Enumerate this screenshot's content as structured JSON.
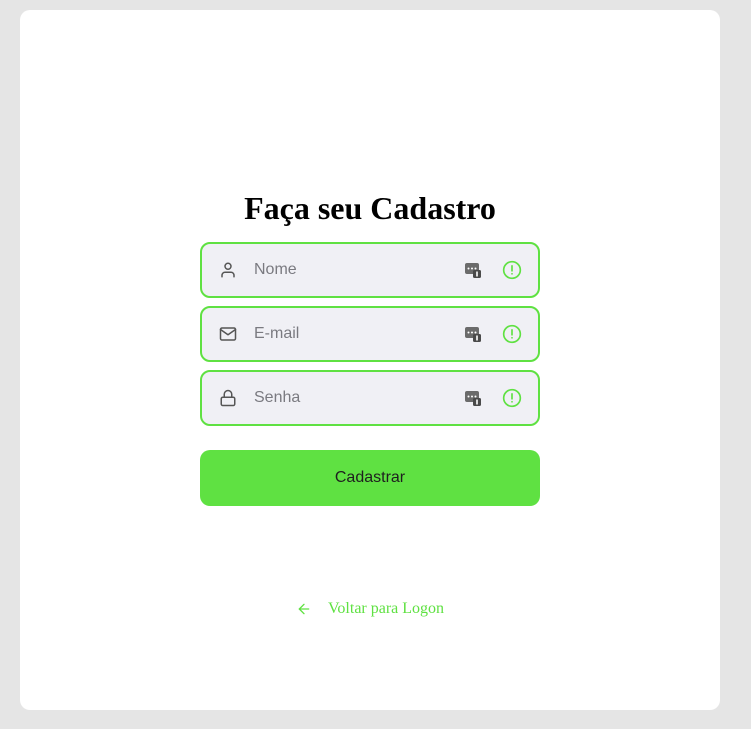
{
  "page": {
    "title": "Faça seu Cadastro"
  },
  "form": {
    "fields": [
      {
        "name": "Nome",
        "placeholder": "Nome",
        "icon": "user-icon"
      },
      {
        "name": "E-mail",
        "placeholder": "E-mail",
        "icon": "mail-icon"
      },
      {
        "name": "Senha",
        "placeholder": "Senha",
        "icon": "lock-icon"
      }
    ],
    "submit_label": "Cadastrar"
  },
  "footer": {
    "back_label": "Voltar para Logon"
  },
  "colors": {
    "accent": "#5fe142",
    "background": "#e5e5e5",
    "card": "#ffffff",
    "input_bg": "#f0f0f5"
  }
}
